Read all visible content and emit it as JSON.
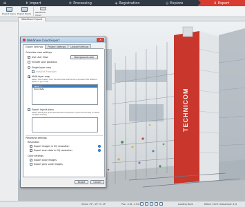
{
  "tabs": [
    {
      "label": "Import",
      "icon": "import-icon"
    },
    {
      "label": "Processing",
      "icon": "processing-icon"
    },
    {
      "label": "Registration",
      "icon": "registration-icon"
    },
    {
      "label": "Explore",
      "icon": "explore-icon"
    },
    {
      "label": "Export",
      "icon": "export-icon",
      "active": true
    }
  ],
  "ribbon": {
    "buttons": [
      "Export Scans",
      "Export Points",
      "Webshare Cloud"
    ]
  },
  "document_tab": "WebShare Export",
  "dialog": {
    "title": "WebShare Cloud Export",
    "close_label": "✕",
    "tabs": [
      "Export Settings",
      "Project Settings",
      "Upload Settings"
    ],
    "overview_header": "Overview map settings",
    "use_user_view": "Use User View",
    "background_color_button": "Background color",
    "include_scan_positions": "Include scan positions",
    "single_layer_map": "Single layer map",
    "use_floor_plan": "Use/Edit Floorplan",
    "multi_layer_map": "Multi-layer map",
    "multi_layer_hint": "Select the clusters from the list below that should represent the different layers in your map",
    "layer_items": [
      "Layer 1",
      "Scan/data"
    ],
    "export_layout_plans": "Export layout plans",
    "layout_hint": "Select the layout plans that should be exported. (Hold the Ctrl key to select multiple entries.)",
    "panorama_header": "Panorama settings",
    "resolution_header": "Resolution",
    "export_images_hq": "Export images in HQ resolution",
    "export_scan_data_hq": "Export scan data in HQ resolution",
    "color_header": "Color settings",
    "export_color_images": "Export color images",
    "export_gray_scale": "Export grey scale images",
    "export_button": "Export",
    "cancel_button": "Cancel"
  },
  "statusbar": {
    "view": "Views: 35°, 45° m: 4P",
    "pos": "Pos: -3.61, 1.54 m",
    "loading": "Loading Done",
    "detail": "Detail: 100%",
    "subsample": "Subsample: 1/4"
  },
  "colors": {
    "accent": "#d83b2f",
    "tabbar": "#2f3a44",
    "building_red": "#c8362c"
  },
  "building_text": "TECHNICOM"
}
